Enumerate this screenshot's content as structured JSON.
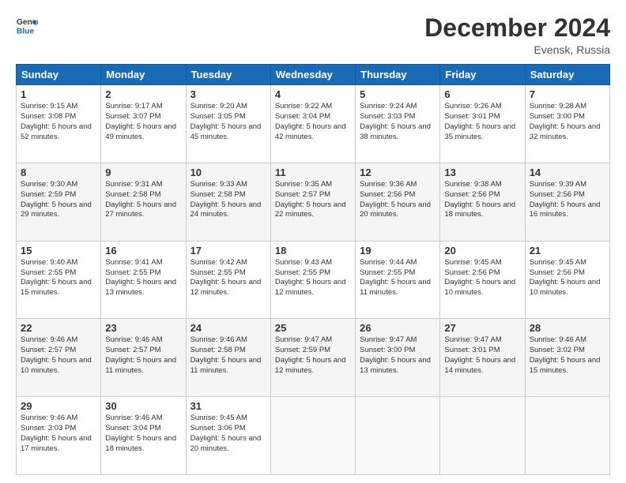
{
  "logo": {
    "line1": "General",
    "line2": "Blue"
  },
  "title": "December 2024",
  "subtitle": "Evensk, Russia",
  "days_header": [
    "Sunday",
    "Monday",
    "Tuesday",
    "Wednesday",
    "Thursday",
    "Friday",
    "Saturday"
  ],
  "weeks": [
    [
      {
        "day": "1",
        "sunrise": "Sunrise: 9:15 AM",
        "sunset": "Sunset: 3:08 PM",
        "daylight": "Daylight: 5 hours and 52 minutes."
      },
      {
        "day": "2",
        "sunrise": "Sunrise: 9:17 AM",
        "sunset": "Sunset: 3:07 PM",
        "daylight": "Daylight: 5 hours and 49 minutes."
      },
      {
        "day": "3",
        "sunrise": "Sunrise: 9:20 AM",
        "sunset": "Sunset: 3:05 PM",
        "daylight": "Daylight: 5 hours and 45 minutes."
      },
      {
        "day": "4",
        "sunrise": "Sunrise: 9:22 AM",
        "sunset": "Sunset: 3:04 PM",
        "daylight": "Daylight: 5 hours and 42 minutes."
      },
      {
        "day": "5",
        "sunrise": "Sunrise: 9:24 AM",
        "sunset": "Sunset: 3:03 PM",
        "daylight": "Daylight: 5 hours and 38 minutes."
      },
      {
        "day": "6",
        "sunrise": "Sunrise: 9:26 AM",
        "sunset": "Sunset: 3:01 PM",
        "daylight": "Daylight: 5 hours and 35 minutes."
      },
      {
        "day": "7",
        "sunrise": "Sunrise: 9:28 AM",
        "sunset": "Sunset: 3:00 PM",
        "daylight": "Daylight: 5 hours and 32 minutes."
      }
    ],
    [
      {
        "day": "8",
        "sunrise": "Sunrise: 9:30 AM",
        "sunset": "Sunset: 2:59 PM",
        "daylight": "Daylight: 5 hours and 29 minutes."
      },
      {
        "day": "9",
        "sunrise": "Sunrise: 9:31 AM",
        "sunset": "Sunset: 2:58 PM",
        "daylight": "Daylight: 5 hours and 27 minutes."
      },
      {
        "day": "10",
        "sunrise": "Sunrise: 9:33 AM",
        "sunset": "Sunset: 2:58 PM",
        "daylight": "Daylight: 5 hours and 24 minutes."
      },
      {
        "day": "11",
        "sunrise": "Sunrise: 9:35 AM",
        "sunset": "Sunset: 2:57 PM",
        "daylight": "Daylight: 5 hours and 22 minutes."
      },
      {
        "day": "12",
        "sunrise": "Sunrise: 9:36 AM",
        "sunset": "Sunset: 2:56 PM",
        "daylight": "Daylight: 5 hours and 20 minutes."
      },
      {
        "day": "13",
        "sunrise": "Sunrise: 9:38 AM",
        "sunset": "Sunset: 2:56 PM",
        "daylight": "Daylight: 5 hours and 18 minutes."
      },
      {
        "day": "14",
        "sunrise": "Sunrise: 9:39 AM",
        "sunset": "Sunset: 2:56 PM",
        "daylight": "Daylight: 5 hours and 16 minutes."
      }
    ],
    [
      {
        "day": "15",
        "sunrise": "Sunrise: 9:40 AM",
        "sunset": "Sunset: 2:55 PM",
        "daylight": "Daylight: 5 hours and 15 minutes."
      },
      {
        "day": "16",
        "sunrise": "Sunrise: 9:41 AM",
        "sunset": "Sunset: 2:55 PM",
        "daylight": "Daylight: 5 hours and 13 minutes."
      },
      {
        "day": "17",
        "sunrise": "Sunrise: 9:42 AM",
        "sunset": "Sunset: 2:55 PM",
        "daylight": "Daylight: 5 hours and 12 minutes."
      },
      {
        "day": "18",
        "sunrise": "Sunrise: 9:43 AM",
        "sunset": "Sunset: 2:55 PM",
        "daylight": "Daylight: 5 hours and 12 minutes."
      },
      {
        "day": "19",
        "sunrise": "Sunrise: 9:44 AM",
        "sunset": "Sunset: 2:55 PM",
        "daylight": "Daylight: 5 hours and 11 minutes."
      },
      {
        "day": "20",
        "sunrise": "Sunrise: 9:45 AM",
        "sunset": "Sunset: 2:56 PM",
        "daylight": "Daylight: 5 hours and 10 minutes."
      },
      {
        "day": "21",
        "sunrise": "Sunrise: 9:45 AM",
        "sunset": "Sunset: 2:56 PM",
        "daylight": "Daylight: 5 hours and 10 minutes."
      }
    ],
    [
      {
        "day": "22",
        "sunrise": "Sunrise: 9:46 AM",
        "sunset": "Sunset: 2:57 PM",
        "daylight": "Daylight: 5 hours and 10 minutes."
      },
      {
        "day": "23",
        "sunrise": "Sunrise: 9:46 AM",
        "sunset": "Sunset: 2:57 PM",
        "daylight": "Daylight: 5 hours and 11 minutes."
      },
      {
        "day": "24",
        "sunrise": "Sunrise: 9:46 AM",
        "sunset": "Sunset: 2:58 PM",
        "daylight": "Daylight: 5 hours and 11 minutes."
      },
      {
        "day": "25",
        "sunrise": "Sunrise: 9:47 AM",
        "sunset": "Sunset: 2:59 PM",
        "daylight": "Daylight: 5 hours and 12 minutes."
      },
      {
        "day": "26",
        "sunrise": "Sunrise: 9:47 AM",
        "sunset": "Sunset: 3:00 PM",
        "daylight": "Daylight: 5 hours and 13 minutes."
      },
      {
        "day": "27",
        "sunrise": "Sunrise: 9:47 AM",
        "sunset": "Sunset: 3:01 PM",
        "daylight": "Daylight: 5 hours and 14 minutes."
      },
      {
        "day": "28",
        "sunrise": "Sunrise: 9:46 AM",
        "sunset": "Sunset: 3:02 PM",
        "daylight": "Daylight: 5 hours and 15 minutes."
      }
    ],
    [
      {
        "day": "29",
        "sunrise": "Sunrise: 9:46 AM",
        "sunset": "Sunset: 3:03 PM",
        "daylight": "Daylight: 5 hours and 17 minutes."
      },
      {
        "day": "30",
        "sunrise": "Sunrise: 9:46 AM",
        "sunset": "Sunset: 3:04 PM",
        "daylight": "Daylight: 5 hours and 18 minutes."
      },
      {
        "day": "31",
        "sunrise": "Sunrise: 9:45 AM",
        "sunset": "Sunset: 3:06 PM",
        "daylight": "Daylight: 5 hours and 20 minutes."
      },
      null,
      null,
      null,
      null
    ]
  ]
}
